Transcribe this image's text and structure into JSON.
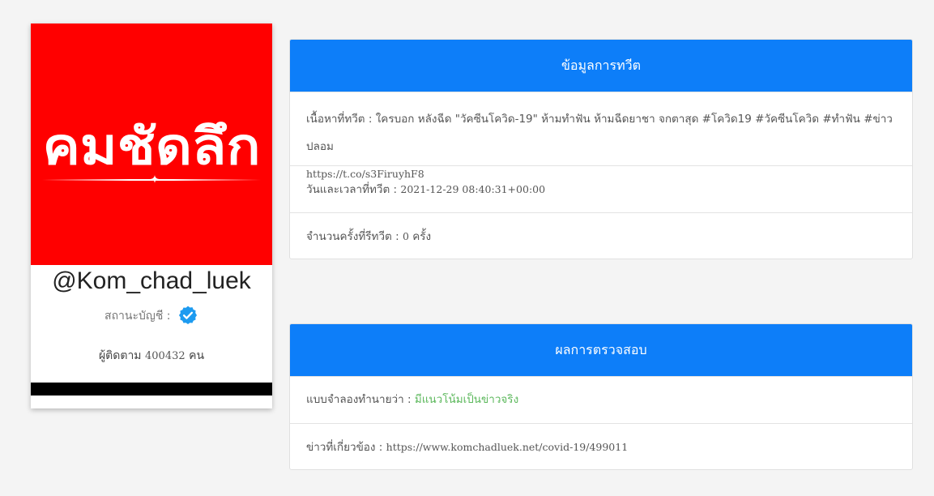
{
  "profile": {
    "avatar_wordmark": "คมชัดลึก",
    "handle": "@Kom_chad_luek",
    "status_label": "สถานะบัญชี :",
    "verified_icon": "verified-badge-icon",
    "followers_label": "ผู้ติดตาม",
    "followers_count": "400432",
    "followers_unit": "คน"
  },
  "tweet_info": {
    "title": "ข้อมูลการทวีต",
    "content_label": "เนื้อหาที่ทวีต :",
    "content_text": "ใครบอก หลังฉีด \"วัคซีนโควิด-19\" ห้ามทำฟัน ห้ามฉีดยาชา จกตาสุด #โควิด19 #วัคซีนโควิด #ทำฟัน #ข่าวปลอม",
    "content_link": "https://t.co/s3FiruyhF8",
    "datetime_label": "วันและเวลาที่ทวีต :",
    "datetime_value": "2021-12-29 08:40:31+00:00",
    "retweet_label": "จำนวนครั้งที่รีทวีต :",
    "retweet_count": "0",
    "retweet_unit": "ครั้ง"
  },
  "check_result": {
    "title": "ผลการตรวจสอบ",
    "prediction_label": "แบบจำลองทำนายว่า :",
    "prediction_value": "มีแนวโน้มเป็นข่าวจริง",
    "related_label": "ข่าวที่เกี่ยวข้อง :",
    "related_url": "https://www.komchadluek.net/covid-19/499011"
  },
  "colors": {
    "header_blue": "#0d7ef9",
    "avatar_red": "#ff0000",
    "prediction_green": "#5cb85c",
    "verified_blue": "#1d9bf0"
  }
}
